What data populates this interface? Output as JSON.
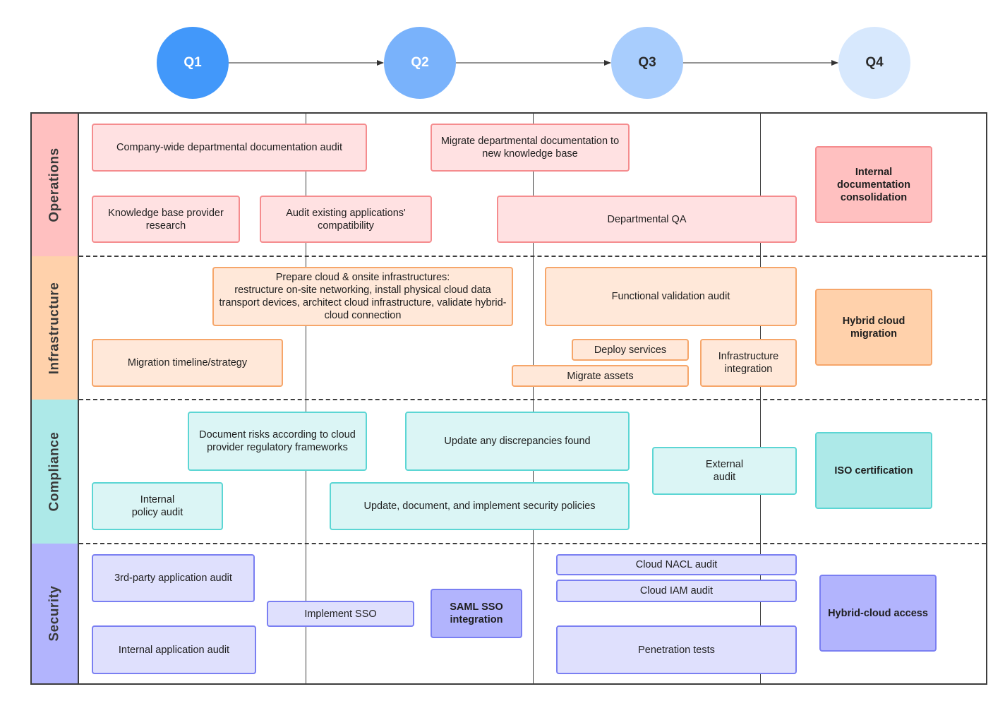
{
  "timeline": {
    "quarters": [
      {
        "label": "Q1",
        "color": "#4298fa"
      },
      {
        "label": "Q2",
        "color": "#79b2fb"
      },
      {
        "label": "Q3",
        "color": "#a8cdfd"
      },
      {
        "label": "Q4",
        "color": "#d7e8fd"
      }
    ]
  },
  "lanes": {
    "operations": {
      "label": "Operations",
      "color": "#ffc0c0",
      "tasks": [
        "Company-wide departmental documentation audit",
        "Knowledge base provider research",
        "Audit existing applications' compatibility",
        "Migrate departmental documentation to new knowledge base",
        "Departmental QA"
      ],
      "goal": "Internal documentation consolidation"
    },
    "infrastructure": {
      "label": "Infrastructure",
      "color": "#ffd1ab",
      "tasks": [
        "Prepare cloud & onsite infrastructures:\nrestructure on-site networking, install physical cloud data transport devices, architect cloud infrastructure, validate hybrid-cloud connection",
        "Migration timeline/strategy",
        "Functional validation audit",
        "Deploy services",
        "Migrate assets",
        "Infrastructure integration"
      ],
      "goal": "Hybrid cloud migration"
    },
    "compliance": {
      "label": "Compliance",
      "color": "#ade9e8",
      "tasks": [
        "Document risks according to cloud provider regulatory frameworks",
        "Update any discrepancies found",
        "Internal\npolicy audit",
        "Update, document, and implement security policies",
        "External\naudit"
      ],
      "goal": "ISO certification"
    },
    "security": {
      "label": "Security",
      "color": "#b2b4fd",
      "tasks": [
        "3rd-party application audit",
        "Internal application audit",
        "Implement SSO",
        "SAML SSO integration",
        "Cloud NACL audit",
        "Cloud IAM audit",
        "Penetration tests"
      ],
      "goal": "Hybrid-cloud access"
    }
  }
}
